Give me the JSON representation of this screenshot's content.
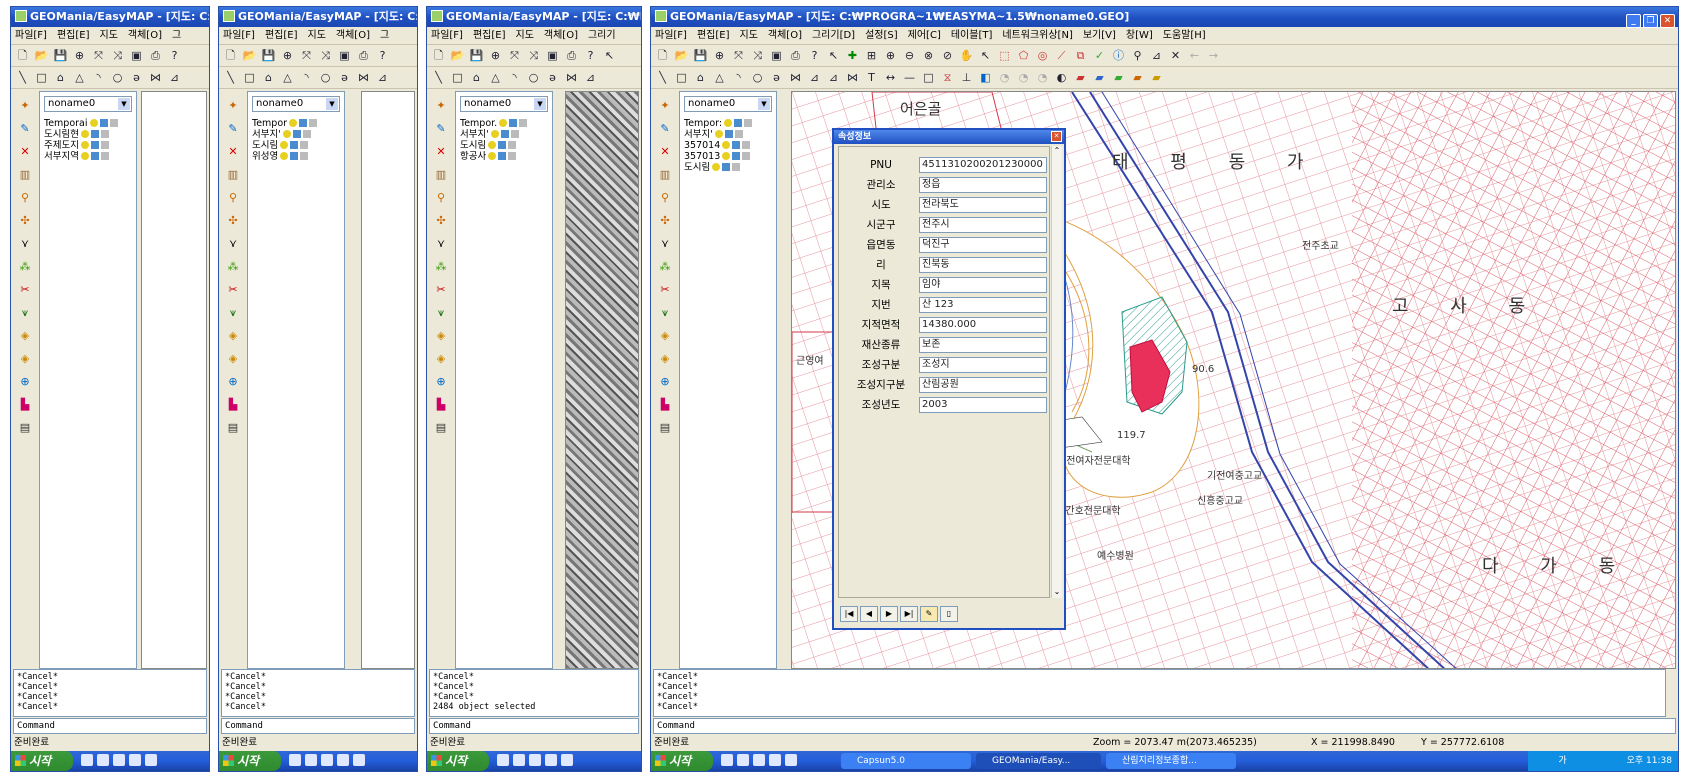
{
  "windows": [
    {
      "title": "GEOMania/EasyMAP - [지도: C:",
      "menu": [
        "파일[F]",
        "편집[E]",
        "지도",
        "객체[O]",
        "그"
      ],
      "layer_combo": "noname0",
      "layers": [
        "Temporai",
        "도시림현",
        "주제도지",
        "서부지역"
      ],
      "log": [
        "*Cancel*",
        "*Cancel*",
        "*Cancel*",
        "*Cancel*"
      ],
      "log_extra": "",
      "command": "Command",
      "status": "준비완료",
      "start": "시작"
    },
    {
      "title": "GEOMania/EasyMAP - [지도: C:",
      "menu": [
        "파일[F]",
        "편집[E]",
        "지도",
        "객체[O]",
        "그"
      ],
      "layer_combo": "noname0",
      "layers": [
        "Tempor",
        "서부지'",
        "도시림",
        "위성영"
      ],
      "log": [
        "*Cancel*",
        "*Cancel*",
        "*Cancel*",
        "*Cancel*"
      ],
      "log_extra": "",
      "command": "Command",
      "status": "준비완료",
      "start": "시작"
    },
    {
      "title": "GEOMania/EasyMAP - [지도: C:₩F",
      "menu": [
        "파일[F]",
        "편집[E]",
        "지도",
        "객체[O]",
        "그리기"
      ],
      "layer_combo": "noname0",
      "layers": [
        "Tempor.",
        "서부지'",
        "도시림",
        "항공사"
      ],
      "log": [
        "*Cancel*",
        "*Cancel*",
        "*Cancel*",
        ""
      ],
      "log_extra": "2484 object selected",
      "command": "Command",
      "status": "준비완료",
      "start": "시작"
    },
    {
      "title": "GEOMania/EasyMAP - [지도: C:₩PROGRA~1₩EASYMA~1.5₩noname0.GEO]",
      "menu": [
        "파일[F]",
        "편집[E]",
        "지도",
        "객체[O]",
        "그리기[D]",
        "설정[S]",
        "제어[C]",
        "테이블[T]",
        "네트워크위상[N]",
        "보기[V]",
        "창[W]",
        "도움말[H]"
      ],
      "layer_combo": "noname0",
      "layers": [
        "Tempor:",
        "서부지'",
        "357014",
        "357013",
        "도시림"
      ],
      "log": [
        "*Cancel*",
        "*Cancel*",
        "*Cancel*",
        "*Cancel*"
      ],
      "log_extra": "",
      "command": "Command",
      "status": "준비완료",
      "start": "시작",
      "zoom": "Zoom = 2073.47  m(2073.465235)",
      "xcoord": "X = 211998.8490",
      "ycoord": "Y = 257772.6108",
      "tasks": [
        "Capsun5.0",
        "GEOMania/Easy...",
        "산림지리정보종합..."
      ],
      "clock": "오후 11:38",
      "tray_lang": "가"
    }
  ],
  "dialog": {
    "title": "속성정보",
    "fields": [
      {
        "label": "PNU",
        "value": "4511310200201230000"
      },
      {
        "label": "관리소",
        "value": "정읍"
      },
      {
        "label": "시도",
        "value": "전라북도"
      },
      {
        "label": "시군구",
        "value": "전주시"
      },
      {
        "label": "읍면동",
        "value": "덕진구"
      },
      {
        "label": "리",
        "value": "진북동"
      },
      {
        "label": "지목",
        "value": "임야"
      },
      {
        "label": "지번",
        "value": "산 123"
      },
      {
        "label": "지적면적",
        "value": "14380.000"
      },
      {
        "label": "재산종류",
        "value": "보존"
      },
      {
        "label": "조성구분",
        "value": "조성지"
      },
      {
        "label": "조성지구분",
        "value": "산림공원"
      },
      {
        "label": "조성년도",
        "value": "2003"
      }
    ]
  },
  "map_labels": {
    "top": "어은골",
    "district1": "태 평 동 가",
    "district2": "고 사 동",
    "district3": "다 가 동",
    "school1": "전주초교",
    "school2": "기전여자전문대학",
    "school3": "기전여중고교",
    "school4": "신흥중고교",
    "school5": "예수간호전문대학",
    "school6": "예수병원",
    "west": "근영여",
    "elev1": "119.7",
    "elev2": "90.6"
  }
}
